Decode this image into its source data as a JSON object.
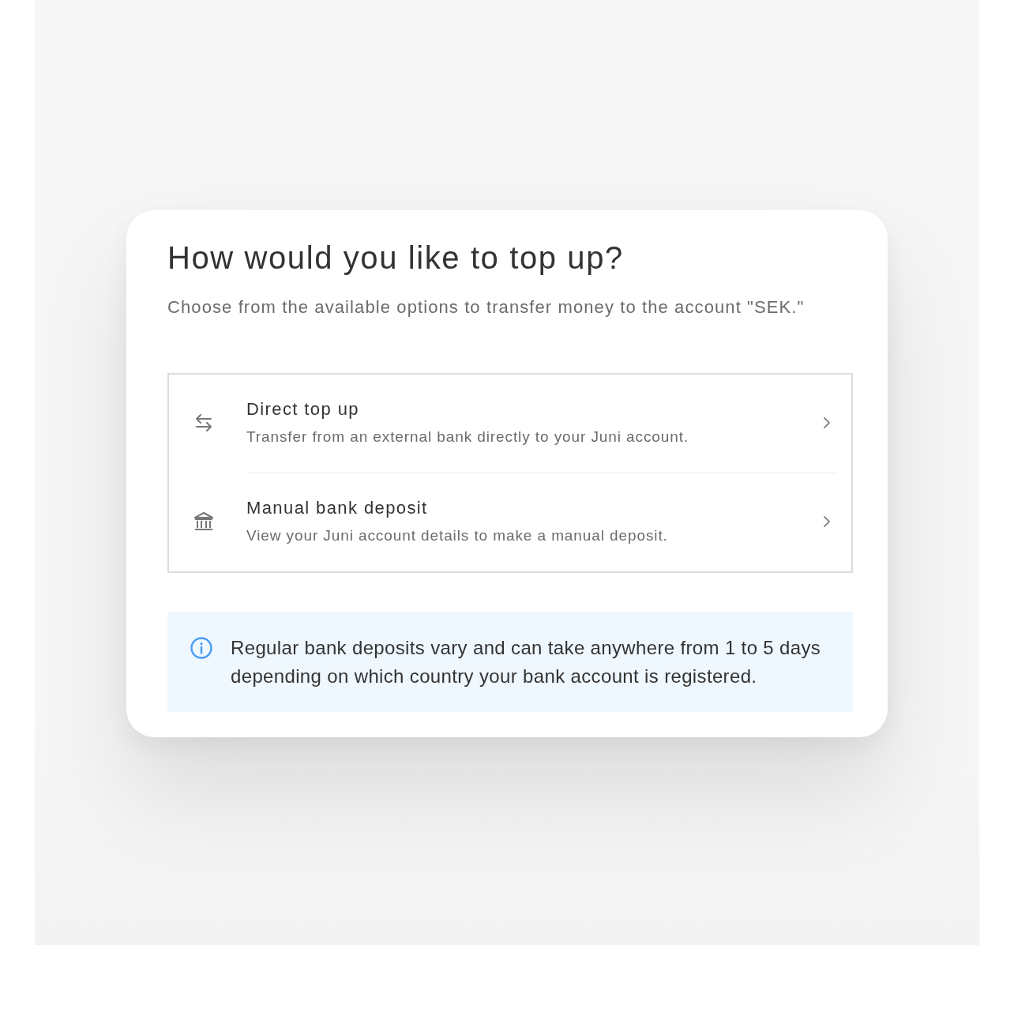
{
  "dialog": {
    "title": "How would you like to top up?",
    "subtitle": "Choose from the available options to transfer money to the account \"SEK.\""
  },
  "options": [
    {
      "kind": "transfer",
      "title": "Direct top up",
      "description": "Transfer from an external bank directly to your Juni account."
    },
    {
      "kind": "bank",
      "title": "Manual bank deposit",
      "description": "View your Juni account details to make a manual deposit."
    }
  ],
  "info": {
    "text": "Regular bank deposits vary and can take anywhere from 1 to 5 days depending on which country your bank account is registered."
  }
}
